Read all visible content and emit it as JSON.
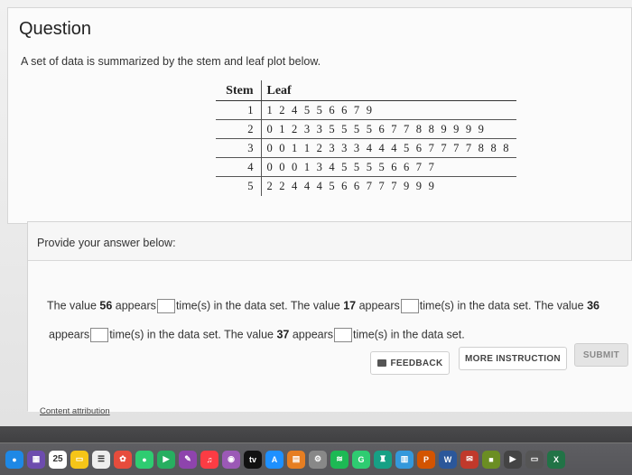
{
  "question": {
    "title": "Question",
    "prompt": "A set of data is summarized by the stem and leaf plot below."
  },
  "stem_leaf": {
    "header_stem": "Stem",
    "header_leaf": "Leaf",
    "rows": [
      {
        "stem": "1",
        "leaf": "1 2 4 5 5 6 6 7 9"
      },
      {
        "stem": "2",
        "leaf": "0 1 2 3 3 5 5 5 5 6 7 7 8 8 9 9 9 9"
      },
      {
        "stem": "3",
        "leaf": "0 0 1 1 2 3 3 3 4 4 4 5 6 7 7 7 7 8 8 8"
      },
      {
        "stem": "4",
        "leaf": "0 0 0 1 3 4 5 5 5 5 6 6 7 7"
      },
      {
        "stem": "5",
        "leaf": "2 2 4 4 4 5 6 6 7 7 7 9 9 9"
      }
    ]
  },
  "answer": {
    "label": "Provide your answer below:",
    "s1_pre": "The value ",
    "v1": "56",
    "s1_mid": " appears",
    "s1_post": "time(s) in the data set. The value ",
    "v2": "17",
    "s2_mid": " appears",
    "s2_post": "time(s) in the data set. The value ",
    "v3": "36",
    "s3_mid": "appears",
    "s3_post": "time(s) in the data set. The value ",
    "v4": "37",
    "s4_mid": " appears",
    "s4_post": "time(s) in the data set."
  },
  "buttons": {
    "feedback": "FEEDBACK",
    "more": "MORE INSTRUCTION",
    "submit": "SUBMIT"
  },
  "attribution": "Content attribution",
  "dock": {
    "calendar_day": "25",
    "tv_label": "tv"
  }
}
